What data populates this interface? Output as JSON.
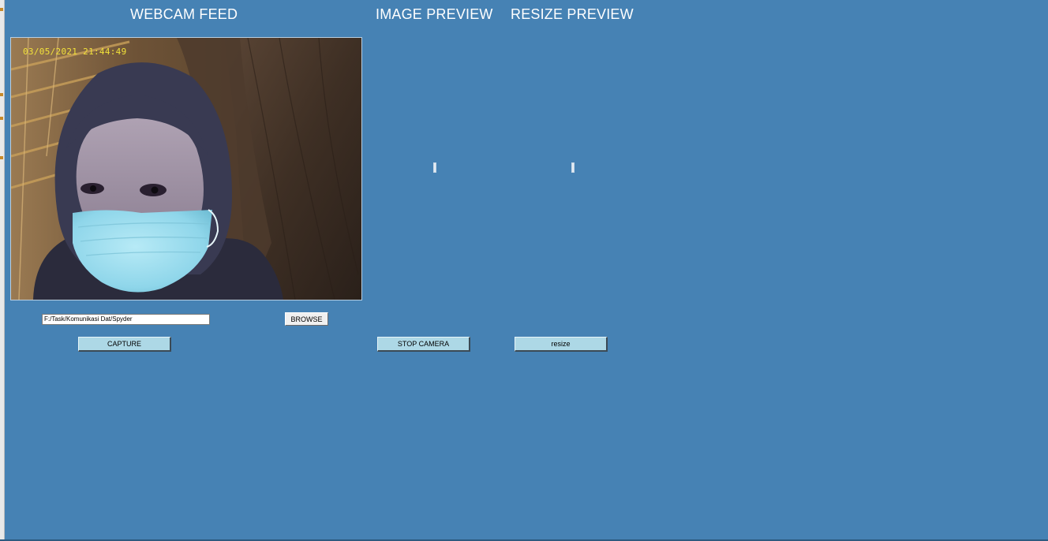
{
  "headings": {
    "webcam": "WEBCAM FEED",
    "image_preview": "IMAGE PREVIEW",
    "resize_preview": "RESIZE PREVIEW"
  },
  "webcam": {
    "timestamp": "03/05/2021 21:44:49"
  },
  "path_field": {
    "value": "F:/Task/Komunikasi Dat/Spyder"
  },
  "buttons": {
    "browse": "BROWSE",
    "capture": "CAPTURE",
    "stop_camera": "STOP CAMERA",
    "resize": "resize"
  },
  "colors": {
    "window_background": "#4682b4",
    "action_button": "#add8e6",
    "heading_text": "#ffffff",
    "timestamp_text": "#f2e23a"
  }
}
